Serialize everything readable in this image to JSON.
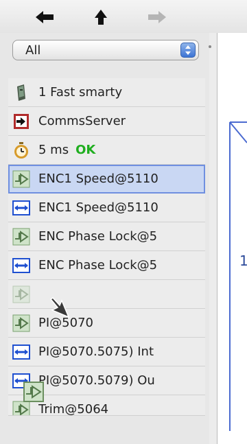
{
  "toolbar": {
    "back_icon": "back-arrow-icon",
    "up_icon": "up-arrow-icon",
    "forward_icon": "forward-arrow-icon"
  },
  "filter": {
    "selected": "All"
  },
  "items": [
    {
      "icon": "device-icon",
      "label": "1 Fast smarty"
    },
    {
      "icon": "server-icon",
      "label": "CommsServer"
    },
    {
      "icon": "stopwatch-icon",
      "label": "5 ms",
      "status": "OK"
    },
    {
      "icon": "block-icon",
      "label": "ENC1 Speed@5110"
    },
    {
      "icon": "link-icon",
      "label": "ENC1 Speed@5110"
    },
    {
      "icon": "block-icon",
      "label": "ENC Phase Lock@5"
    },
    {
      "icon": "link-icon",
      "label": "ENC Phase Lock@5"
    },
    {
      "icon": "block-icon",
      "label": ""
    },
    {
      "icon": "block-icon",
      "label": "PI@5070"
    },
    {
      "icon": "link-icon",
      "label": "PI@5070.5075) Int"
    },
    {
      "icon": "link-icon",
      "label": "PI@5070.5079) Ou"
    },
    {
      "icon": "block-icon",
      "label": "Trim@5064"
    }
  ],
  "canvas": {
    "visible_text": "1"
  },
  "colors": {
    "accent": "#3d74d4",
    "ok": "#1fae1f",
    "selection": "#c9d7f3",
    "link": "#1e4fd0"
  }
}
